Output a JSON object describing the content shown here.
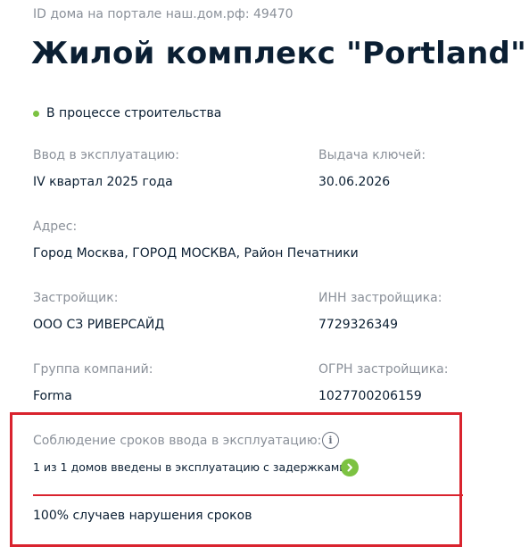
{
  "house": {
    "id_label": "ID дома на портале наш.дом.рф: 49470",
    "title": "Жилой комплекс \"Portland\"",
    "status": "В процессе строительства"
  },
  "details": {
    "commissioning_label": "Ввод в эксплуатацию:",
    "commissioning_value": "IV квартал 2025 года",
    "keys_label": "Выдача ключей:",
    "keys_value": "30.06.2026",
    "address_label": "Адрес:",
    "address_value": "Город Москва, ГОРОД МОСКВА, Район Печатники",
    "developer_label": "Застройщик:",
    "developer_value": "ООО СЗ РИВЕРСАЙД",
    "inn_label": "ИНН застройщика:",
    "inn_value": "7729326349",
    "group_label": "Группа компаний:",
    "group_value": "Forma",
    "ogrn_label": "ОГРН застройщика:",
    "ogrn_value": "1027700206159"
  },
  "deadlines": {
    "label": "Соблюдение сроков ввода в эксплуатацию:",
    "delay_text": "1 из 1 домов введены в эксплуатацию с задержками",
    "violations_text": "100% случаев нарушения сроков"
  },
  "icons": {
    "info": "info-icon",
    "go": "chevron-right-icon"
  },
  "colors": {
    "status_green": "#7cc242",
    "highlight_red": "#d9232e",
    "text_dark": "#0b1f33",
    "text_muted": "#8a9099"
  }
}
